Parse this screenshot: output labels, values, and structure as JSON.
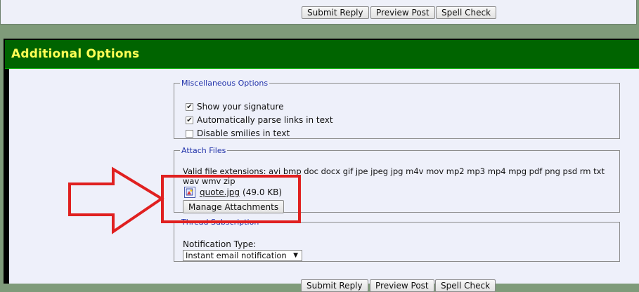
{
  "top_toolbar": {
    "submit_label": "Submit Reply",
    "preview_label": "Preview Post",
    "spell_label": "Spell Check"
  },
  "section": {
    "title": "Additional Options"
  },
  "misc": {
    "legend": "Miscellaneous Options",
    "options": [
      {
        "label": "Show your signature",
        "checked": true
      },
      {
        "label": "Automatically parse links in text",
        "checked": true
      },
      {
        "label": "Disable smilies in text",
        "checked": false
      }
    ]
  },
  "attach": {
    "legend": "Attach Files",
    "extensions": "Valid file extensions: avi bmp doc docx gif jpe jpeg jpg m4v mov mp2 mp3 mp4 mpg pdf png psd rm txt wav wmv zip",
    "file_name": "quote.jpg",
    "file_size": "(49.0 KB)",
    "manage_label": "Manage Attachments"
  },
  "thread": {
    "legend": "Thread Subscription",
    "notification_label": "Notification Type:",
    "notification_value": "Instant email notification"
  },
  "bottom_toolbar": {
    "submit_label": "Submit Reply",
    "preview_label": "Preview Post",
    "spell_label": "Spell Check"
  },
  "colors": {
    "header_bg": "#006400",
    "header_text": "#ffff55",
    "annotation": "#e02020"
  }
}
